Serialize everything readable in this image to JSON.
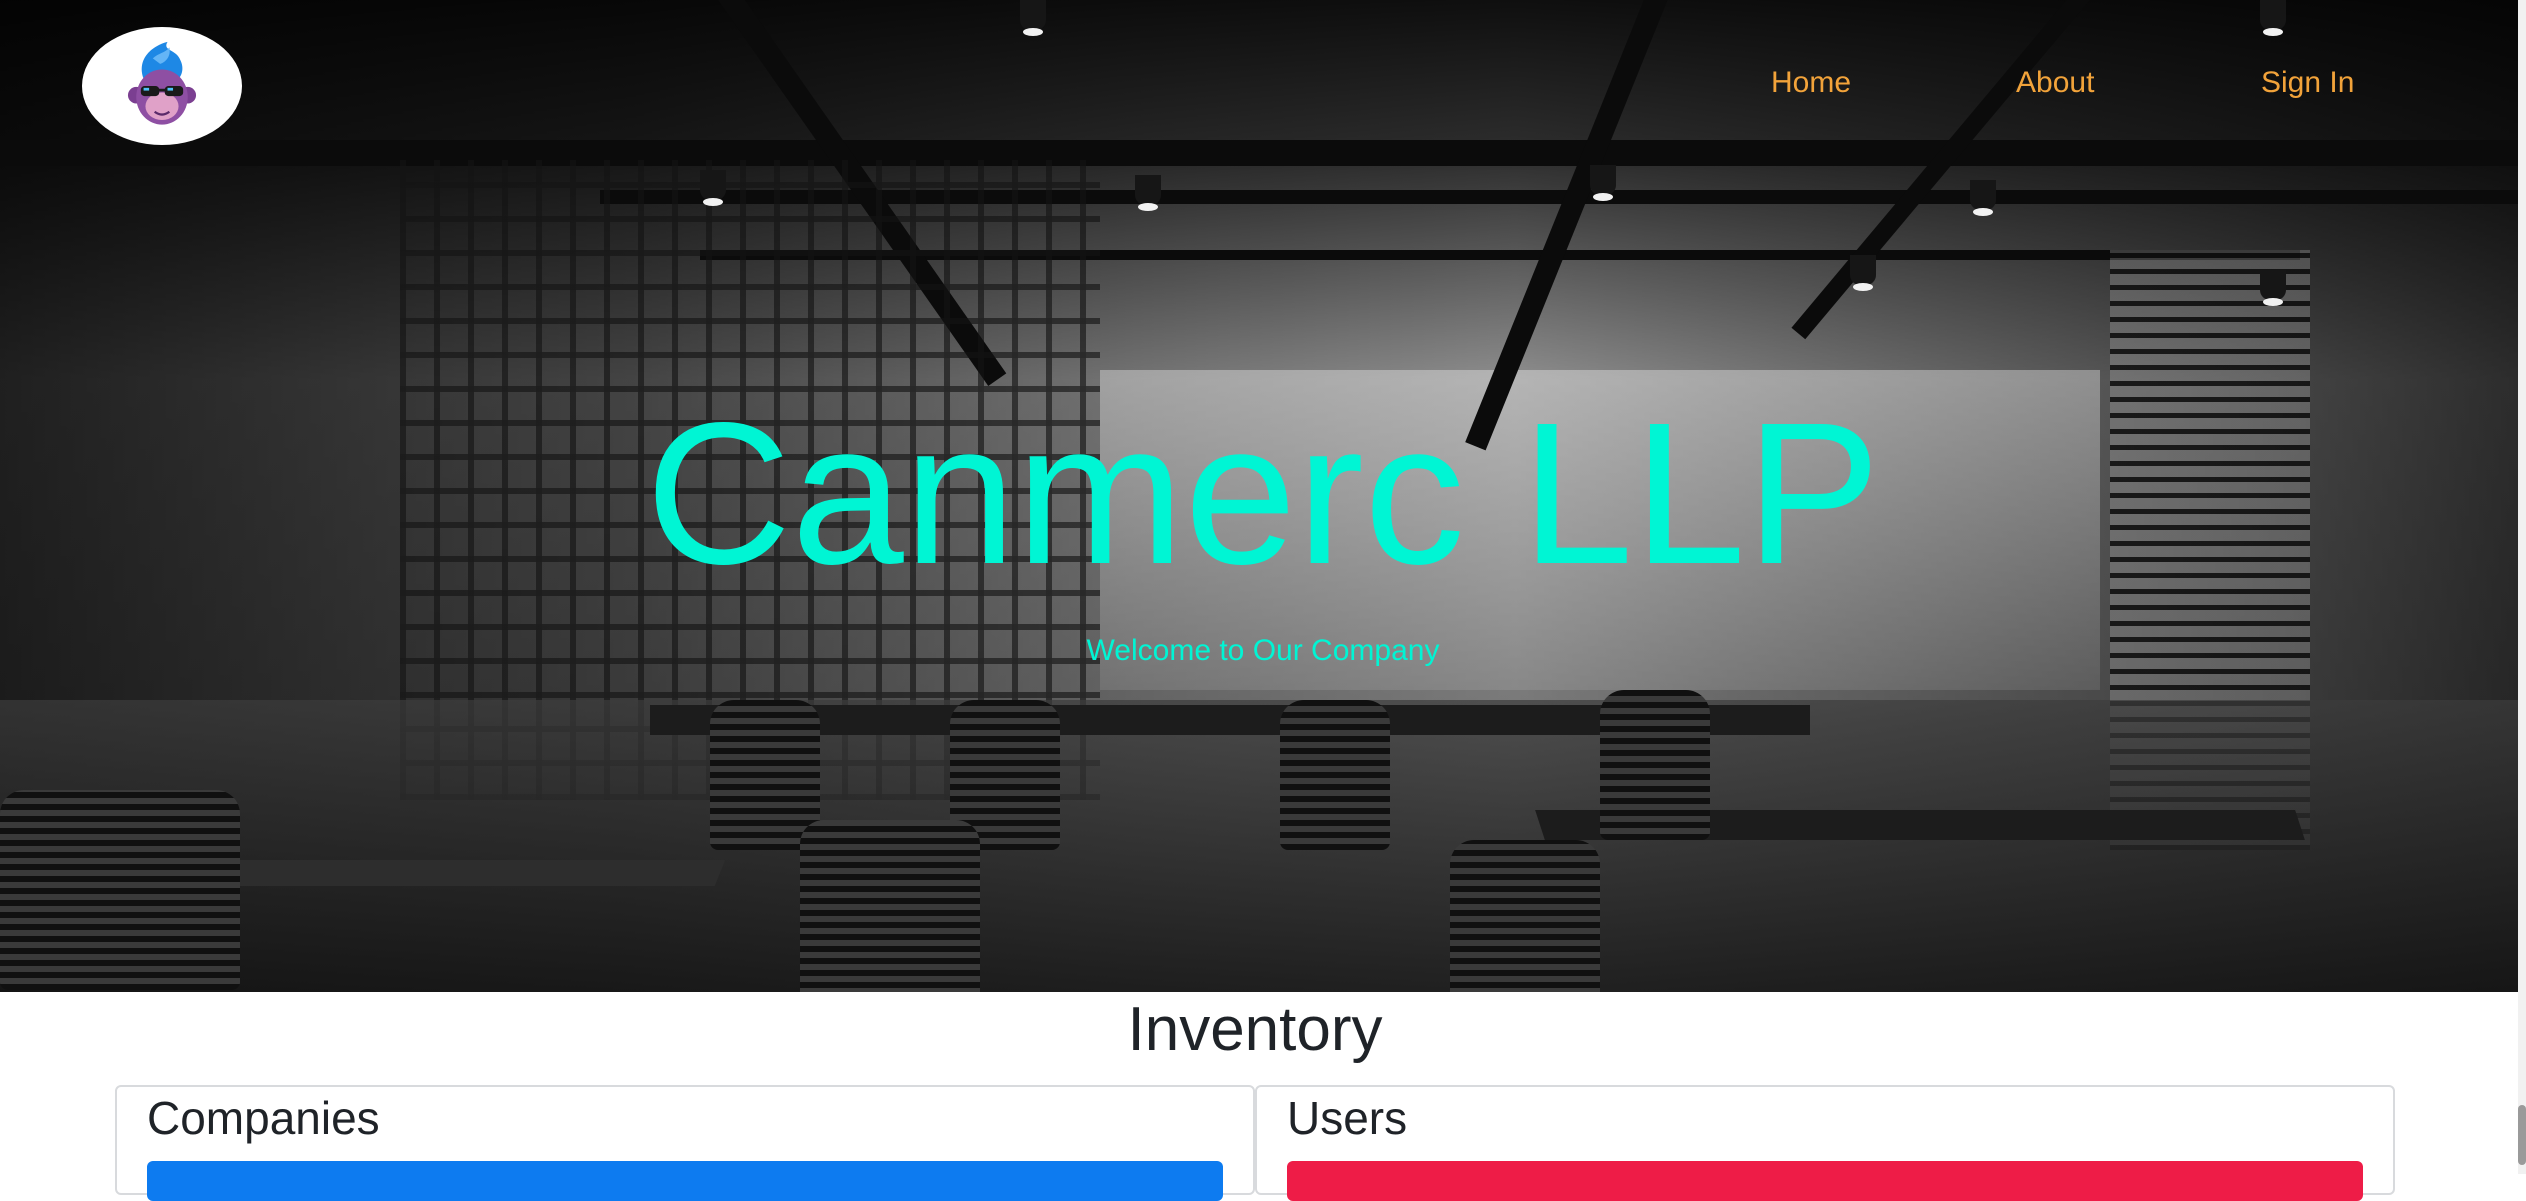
{
  "brand": {
    "logo_icon": "monkey-sunglasses-logo-icon",
    "logo_colors": {
      "hair": "#1e88e5",
      "face": "#8e4fa3",
      "glasses": "#1a1a1a"
    }
  },
  "nav": {
    "items": [
      {
        "label": "Home"
      },
      {
        "label": "About"
      },
      {
        "label": "Sign In"
      }
    ],
    "link_color": "#f2a33a"
  },
  "hero": {
    "title": "Canmerc LLP",
    "subtitle": "Welcome to Our Company",
    "text_color": "#00f5d4",
    "background": "black-and-white-office-photo"
  },
  "inventory": {
    "title": "Inventory",
    "cards": [
      {
        "title": "Companies",
        "bar_color": "#0d7bf0"
      },
      {
        "title": "Users",
        "bar_color": "#ee1c47"
      }
    ]
  }
}
